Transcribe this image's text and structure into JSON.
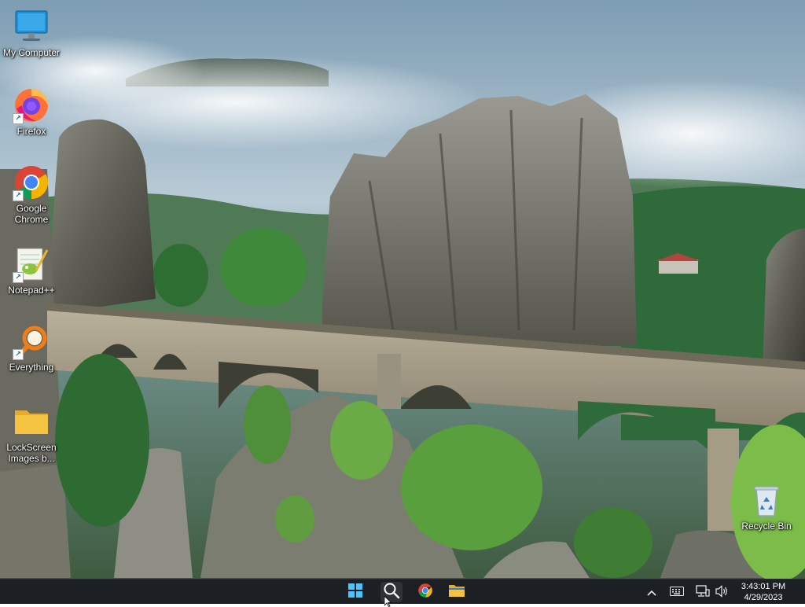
{
  "desktop": {
    "icons": [
      {
        "label": "My Computer",
        "icon": "monitor-icon"
      },
      {
        "label": "Firefox",
        "icon": "firefox-icon"
      },
      {
        "label": "Google Chrome",
        "icon": "chrome-icon"
      },
      {
        "label": "Notepad++",
        "icon": "notepadpp-icon"
      },
      {
        "label": "Everything",
        "icon": "search-magnifier-icon"
      },
      {
        "label": "LockScreen Images b...",
        "icon": "folder-icon"
      },
      {
        "label": "Recycle Bin",
        "icon": "recycle-bin-icon"
      }
    ]
  },
  "taskbar": {
    "pinned": [
      {
        "name": "Start",
        "icon": "windows-start-icon"
      },
      {
        "name": "Search",
        "icon": "search-icon"
      },
      {
        "name": "Google Chrome",
        "icon": "chrome-icon"
      },
      {
        "name": "File Explorer",
        "icon": "file-explorer-icon"
      }
    ],
    "tray": {
      "icons": [
        "chevron-up-icon",
        "keyboard-icon",
        "network-icon",
        "volume-icon"
      ],
      "time": "3:43:01 PM",
      "date": "4/29/2023"
    }
  },
  "colors": {
    "taskbar_bg": "#1c1f24",
    "folder_yellow": "#f5c342",
    "chrome_red": "#db4437",
    "chrome_yellow": "#f4b400",
    "chrome_green": "#0f9d58",
    "chrome_blue": "#4285f4"
  }
}
